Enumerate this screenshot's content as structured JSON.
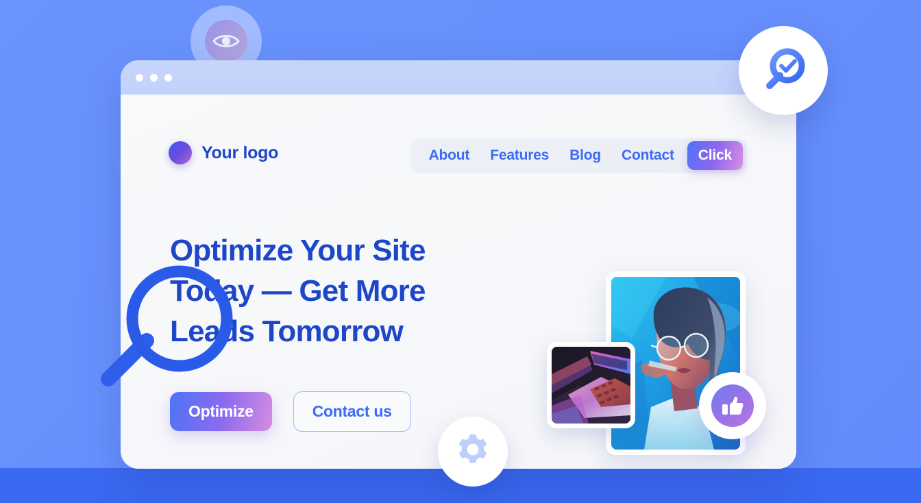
{
  "background": {
    "color_top": "#6B93FD",
    "color_bottom": "#628CFB",
    "band_color": "#3B6AF2"
  },
  "browser_window": {
    "titlebar": {
      "color": "#C5D3FA",
      "dots": [
        "window-dot-1",
        "window-dot-2",
        "window-dot-3"
      ]
    }
  },
  "site": {
    "brand": {
      "name": "Your logo",
      "mark_icon": "gradient-circle-logo-icon",
      "mark_gradient_from": "#3E5BEF",
      "mark_gradient_to": "#B06BD8"
    },
    "nav": {
      "links": [
        {
          "label": "About"
        },
        {
          "label": "Features"
        },
        {
          "label": "Blog"
        },
        {
          "label": "Contact"
        }
      ],
      "cta": {
        "label": "Click",
        "gradient_from": "#5274F6",
        "gradient_to": "#D98DE2"
      },
      "link_color": "#3C6BF7"
    },
    "hero": {
      "title": "Optimize Your Site Today — Get More Leads Tomorrow",
      "title_color": "#1E46C8",
      "primary_button": {
        "label": "Optimize",
        "gradient_from": "#4E74F6",
        "gradient_to": "#D58CE2"
      },
      "secondary_button": {
        "label": "Contact us",
        "text_color": "#3C6BF7",
        "border_color": "#9FB8FA"
      },
      "images": [
        {
          "name": "portrait-photo",
          "description": "Woman with glasses in neon blue lighting"
        },
        {
          "name": "laptop-photo",
          "description": "Laptop keyboard lit with pink and purple neon light"
        }
      ]
    }
  },
  "floating_badges": [
    {
      "name": "eye-badge",
      "icon": "eye-icon"
    },
    {
      "name": "search-check-badge",
      "icon": "magnifier-check-icon",
      "icon_color": "#4A7BF7"
    },
    {
      "name": "thumbs-up-badge",
      "icon": "thumbs-up-icon",
      "icon_color": "#FFFFFF"
    },
    {
      "name": "gear-badge",
      "icon": "gear-icon",
      "icon_color": "#BCD0FB"
    }
  ],
  "overlay": {
    "magnifier": {
      "name": "large-magnifier-overlay",
      "icon": "magnifier-icon",
      "color": "#2A5BE8"
    }
  }
}
